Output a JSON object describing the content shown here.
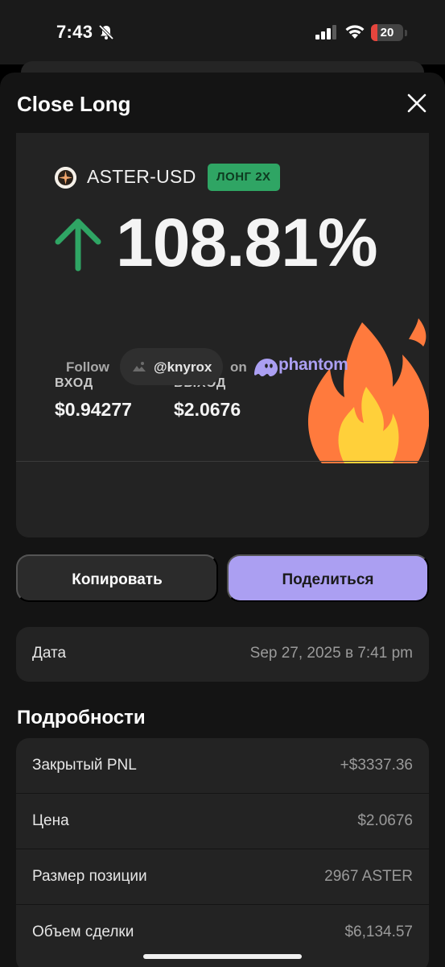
{
  "status_bar": {
    "time": "7:43",
    "battery": "20",
    "battery_level": 0.2
  },
  "sheet": {
    "title": "Close Long"
  },
  "card": {
    "pair": "ASTER-USD",
    "side_badge": "ЛОНГ 2X",
    "pnl_percent": "108.81%",
    "entry_label": "ВХОД",
    "entry_value": "$0.94277",
    "exit_label": "ВЫХОД",
    "exit_value": "$2.0676",
    "follow_label": "Follow",
    "handle": "@knyrox",
    "on_label": "on",
    "brand": "phantom",
    "colors": {
      "positive": "#2fa564",
      "brand": "#ab9ff2",
      "fire": "#ff7a3d"
    }
  },
  "actions": {
    "copy_label": "Копировать",
    "share_label": "Поделиться"
  },
  "date_row": {
    "label": "Дата",
    "value": "Sep 27, 2025 в 7:41 pm"
  },
  "details": {
    "heading": "Подробности",
    "rows": [
      {
        "label": "Закрытый PNL",
        "value": "+$3337.36"
      },
      {
        "label": "Цена",
        "value": "$2.0676"
      },
      {
        "label": "Размер позиции",
        "value": "2967 ASTER"
      },
      {
        "label": "Объем сделки",
        "value": "$6,134.57"
      }
    ]
  }
}
